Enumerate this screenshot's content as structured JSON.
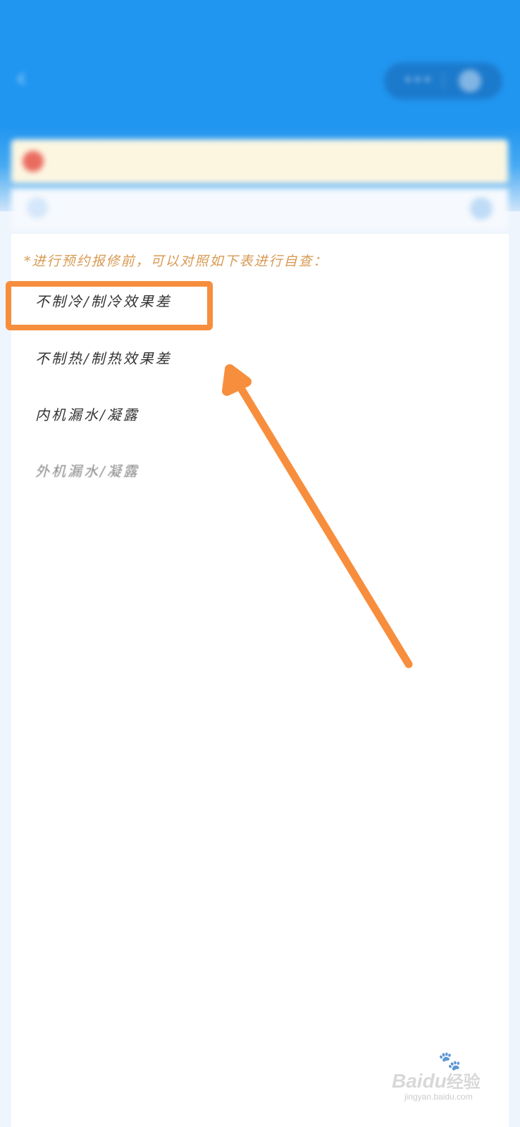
{
  "status_bar": {
    "left_text": "",
    "right_text": ""
  },
  "nav": {
    "title": ""
  },
  "notice": {
    "text": ""
  },
  "product": {
    "label": "",
    "select_text": ""
  },
  "hint": "*进行预约报修前，可以对照如下表进行自查：",
  "issues": [
    "不制冷/制冷效果差",
    "不制热/制热效果差",
    "内机漏水/凝露",
    "外机漏水/凝露",
    "",
    "",
    "",
    "",
    "",
    ""
  ],
  "watermark": {
    "brand": "Bai",
    "brand_cn": "经验",
    "url": "jingyan.baidu.com"
  },
  "colors": {
    "header_blue": "#2196f0",
    "highlight_orange": "#f78e3d",
    "hint_orange": "#d89a52"
  }
}
